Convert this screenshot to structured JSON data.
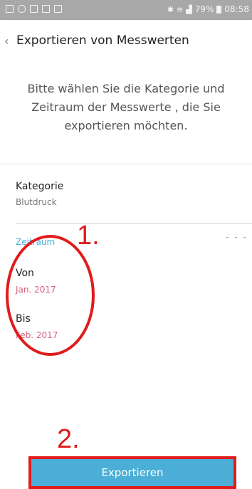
{
  "status_bar": {
    "battery": "79%",
    "time": "08:58",
    "left_icons": [
      "image-icon",
      "cloud-icon",
      "image-icon",
      "message-icon",
      "image-icon"
    ],
    "right_icons": [
      "bluetooth-icon",
      "wifi-icon",
      "signal-icon",
      "battery-icon"
    ]
  },
  "header": {
    "back_icon": "chevron-left-icon",
    "title": "Exportieren von Messwerten"
  },
  "intro_text": "Bitte wählen Sie die Kategorie und Zeitraum der Messwerte , die Sie exportieren möchten.",
  "category": {
    "label": "Kategorie",
    "value": "Blutdruck"
  },
  "period": {
    "section_label": "Zeitraum",
    "trailing": "- - -",
    "from_label": "Von",
    "from_value": "Jan. 2017",
    "to_label": "Bis",
    "to_value": "Feb. 2017"
  },
  "annotations": {
    "step1": "1.",
    "step2": "2."
  },
  "export_button": "Exportieren",
  "colors": {
    "status_bar": "#a8a8a8",
    "accent": "#4aaed6",
    "annotation_red": "#e11b1b",
    "date_pink": "#d6607a"
  }
}
